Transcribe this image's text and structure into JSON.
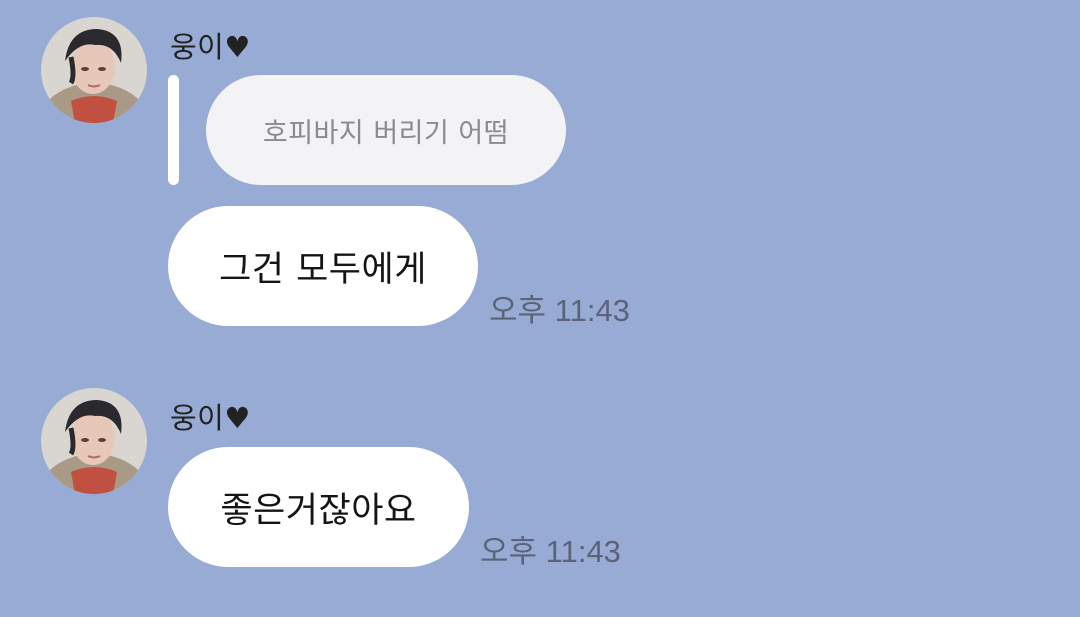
{
  "chat": {
    "messages": [
      {
        "sender": "웅이♥",
        "quoted_text": "호피바지 버리기 어떰",
        "text": "그건 모두에게",
        "time": "오후 11:43"
      },
      {
        "sender": "웅이♥",
        "text": "좋은거잖아요",
        "time": "오후 11:43"
      }
    ]
  },
  "colors": {
    "background": "#98abd5",
    "bubble": "#ffffff",
    "quoted_bubble": "#f3f3f5",
    "quoted_text": "#8a8a8f",
    "timestamp": "#5a6378"
  },
  "icons": {
    "avatar": "profile-photo"
  }
}
